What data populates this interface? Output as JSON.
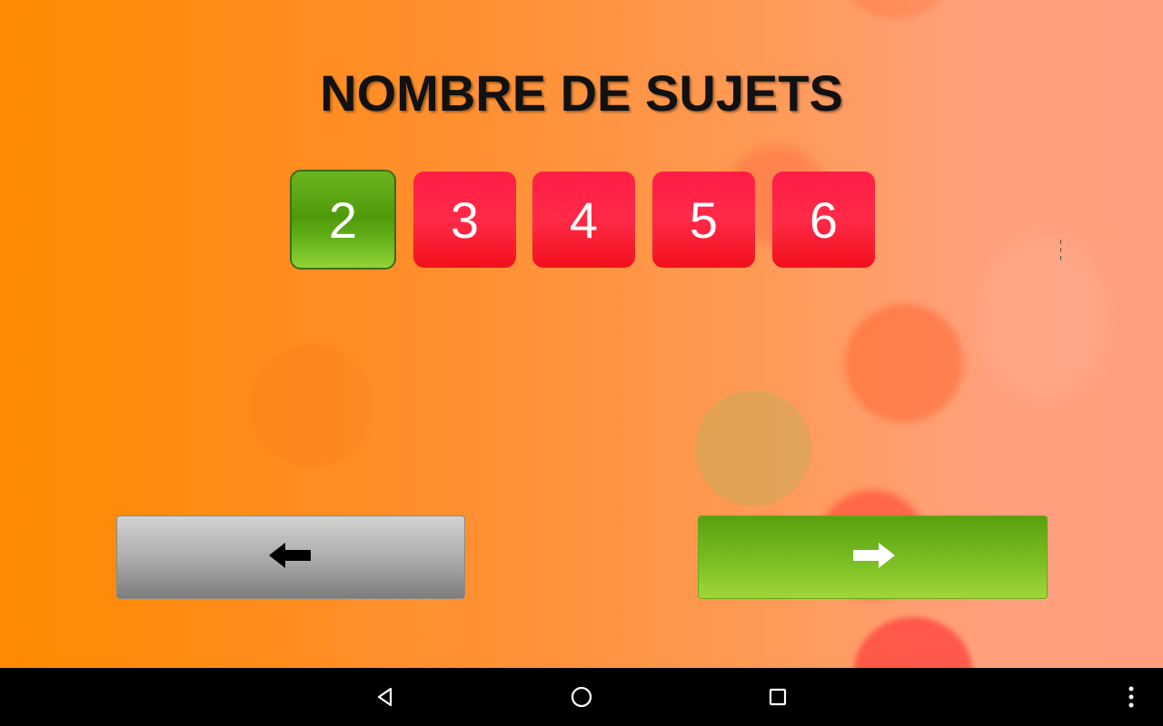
{
  "screen": {
    "title": "NOMBRE DE SUJETS"
  },
  "subject_count": {
    "options": [
      "2",
      "3",
      "4",
      "5",
      "6"
    ],
    "selected": "2"
  },
  "navigation": {
    "back_icon": "arrow-left-icon",
    "next_icon": "arrow-right-icon"
  },
  "system_bar": {
    "icons": [
      "back-triangle-icon",
      "home-circle-icon",
      "recents-square-icon",
      "overflow-menu-icon"
    ]
  },
  "colors": {
    "background_start": "#ff8a00",
    "background_end": "#ff9e7e",
    "selected_option": "#4f9a0a",
    "unselected_option": "#ff1d45",
    "back_button": "#a9a9a9",
    "next_button": "#79be22",
    "title_text": "#111111"
  }
}
